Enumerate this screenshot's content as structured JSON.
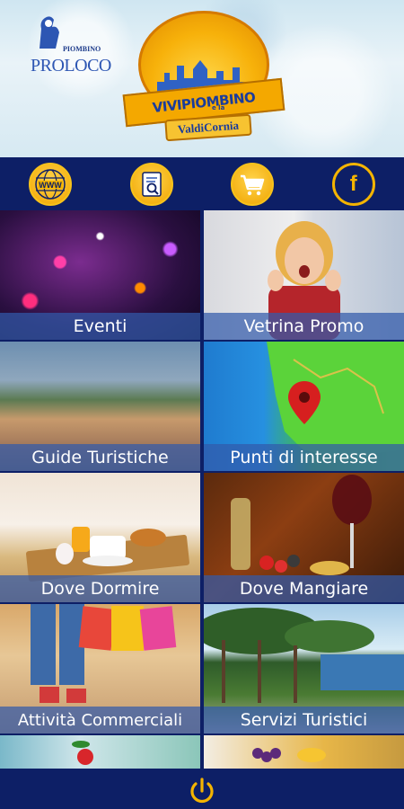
{
  "header": {
    "proloco": {
      "small_text": "PIOMBINO",
      "big_text": "PROLOCO"
    },
    "logo": {
      "main_text": "VIVIPIOMBINO",
      "connector": "e la",
      "sub_text": "ValdiCornia"
    }
  },
  "toolbar": {
    "items": [
      {
        "icon": "globe-www-icon",
        "text": "WWW"
      },
      {
        "icon": "search-document-icon"
      },
      {
        "icon": "shopping-cart-icon"
      },
      {
        "icon": "facebook-icon",
        "text": "f"
      }
    ]
  },
  "tiles": [
    {
      "label": "Eventi"
    },
    {
      "label": "Vetrina Promo"
    },
    {
      "label": "Guide Turistiche"
    },
    {
      "label": "Punti di interesse"
    },
    {
      "label": "Dove Dormire"
    },
    {
      "label": "Dove Mangiare"
    },
    {
      "label": "Attività Commerciali"
    },
    {
      "label": "Servizi Turistici"
    }
  ],
  "bottom": {
    "icon": "power-icon"
  },
  "colors": {
    "navy": "#0d1f66",
    "gold": "#f4b400",
    "label_bg": "#325aaa"
  }
}
